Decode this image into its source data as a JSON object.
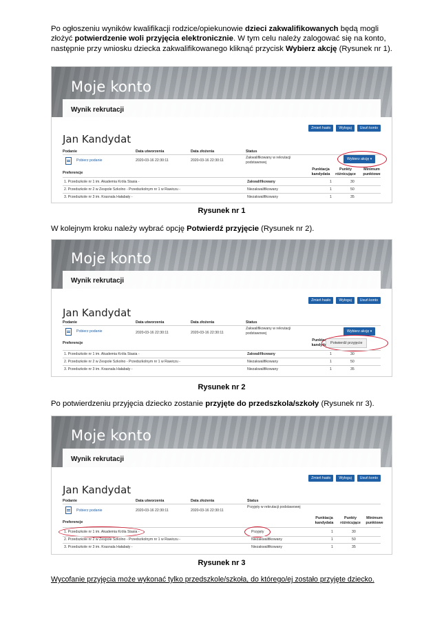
{
  "intro": {
    "part1": "Po ogłoszeniu wyników kwalifikacji rodzice/opiekunowie ",
    "bold1": "dzieci zakwalifikowanych",
    "part2": " będą mogli złożyć ",
    "bold2": "potwierdzenie woli przyjęcia elektronicznie",
    "part3": ". W tym celu należy zalogować się na konto, następnie przy wniosku dziecka zakwalifikowanego kliknąć przycisk ",
    "bold3": "Wybierz akcję",
    "part4": " (Rysunek nr 1)."
  },
  "step2": {
    "part1": "W kolejnym kroku należy wybrać opcję ",
    "bold1": "Potwierdź przyjęcie",
    "part2": " (Rysunek nr 2)."
  },
  "step3": {
    "part1": "Po potwierdzeniu przyjęcia dziecko zostanie ",
    "bold1": "przyjęte do przedszkola/szkoły",
    "part2": " (Rysunek nr 3)."
  },
  "footer_note": "Wycofanie przyjęcia może wykonać tylko przedszkole/szkoła, do którego/ej zostało przyjęte dziecko.",
  "captions": [
    "Rysunek nr 1",
    "Rysunek nr 2",
    "Rysunek nr 3"
  ],
  "ui": {
    "title": "Moje konto",
    "subtitle": "Wynik rekrutacji",
    "buttons": [
      "Zmień hasło",
      "Wyloguj",
      "Usuń konto"
    ],
    "candidate": "Jan Kandydat",
    "headers": {
      "podanie": "Podanie",
      "utworzenia": "Data utworzenia",
      "zlozenia": "Data złożenia",
      "status": "Status",
      "preferencje": "Preferencje",
      "punktacja": "Punktacja kandydata",
      "punkty": "Punkty różnicujące",
      "minimum": "Minimum punktowe"
    },
    "download_link": "Pobierz podanie",
    "date_created": "2020-03-16 22:30:11",
    "date_submitted": "2020-03-16 22:30:11",
    "action_button": "Wybierz akcję",
    "dropdown_option": "Potwierdź przyjęcie",
    "preferences": [
      "1. Przedszkole nr 1 im. Akademia Króla Stasia -",
      "2. Przedszkole nr 2 w Zespole Szkolno - Przedszkolnym nr 1 w Rawiczu -",
      "3. Przedszkole nr 3 im. Krasnala Hałabały -"
    ],
    "punktacja_values": [
      "1",
      "1",
      "1"
    ],
    "punkty_values": [
      "30",
      "50",
      "35"
    ]
  },
  "shots": [
    {
      "status": "Zakwalifikowany w rekrutacji podstawowej",
      "pref_status": [
        "Zakwalifikowany",
        "Niezakwalifikowany",
        "Niezakwalifikowany"
      ]
    },
    {
      "status": "Zakwalifikowany w rekrutacji podstawowej",
      "pref_status": [
        "Zakwalifikowany",
        "Niezakwalifikowany",
        "Niezakwalifikowany"
      ]
    },
    {
      "status": "Przyjęty w rekrutacji podstawowej",
      "pref_status": [
        "Przyjęty",
        "Niezakwalifikowany",
        "Niezakwalifikowany"
      ]
    }
  ],
  "colors": {
    "accent": "#1f5fa6",
    "highlight_ellipse": "#d0142b"
  }
}
